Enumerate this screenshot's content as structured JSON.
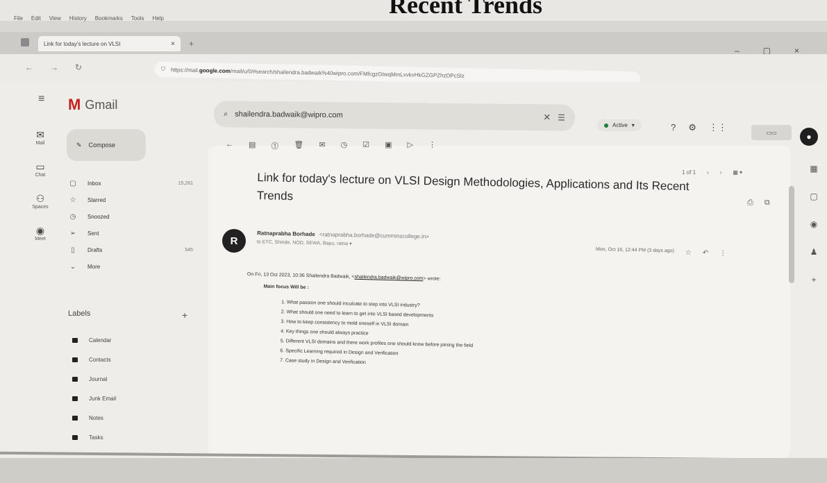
{
  "slide_title": "Recent Trends",
  "menu": [
    "File",
    "Edit",
    "View",
    "History",
    "Bookmarks",
    "Tools",
    "Help"
  ],
  "tab": {
    "title": "Link for today's lecture on VLSI",
    "close": "×",
    "new": "+"
  },
  "window_controls": [
    "–",
    "▢",
    "×"
  ],
  "nav": {
    "back": "←",
    "forward": "→",
    "reload": "↻"
  },
  "url": {
    "prefix": "https://mail.",
    "domain": "google.com",
    "rest": "/mail/u/0/#search/shailendra.badwaik%40wipro.com/FMfcgzGtwqMmLxvkvHkGZGPZhzDPcSlz"
  },
  "gmail": {
    "brand": "Gmail",
    "compose": "Compose",
    "rail": [
      {
        "icon": "✉",
        "label": "Mail"
      },
      {
        "icon": "▭",
        "label": "Chat"
      },
      {
        "icon": "⚇",
        "label": "Spaces"
      },
      {
        "icon": "◉",
        "label": "Meet"
      }
    ],
    "folders": [
      {
        "icon": "▢",
        "label": "Inbox",
        "count": "15,261"
      },
      {
        "icon": "☆",
        "label": "Starred",
        "count": ""
      },
      {
        "icon": "◷",
        "label": "Snoozed",
        "count": ""
      },
      {
        "icon": "➢",
        "label": "Sent",
        "count": ""
      },
      {
        "icon": "▯",
        "label": "Drafts",
        "count": "545"
      },
      {
        "icon": "⌄",
        "label": "More",
        "count": ""
      }
    ],
    "labels_heading": "Labels",
    "labels": [
      "Calendar",
      "Contacts",
      "Journal",
      "Junk Email",
      "Notes",
      "Tasks"
    ],
    "search": {
      "query": "shailendra.badwaik@wipro.com"
    },
    "status": "Active",
    "pager": "1 of 1",
    "subject": "Link for today's lecture on VLSI Design Methodologies, Applications and Its Recent Trends",
    "sender": {
      "initial": "R",
      "name": "Ratnaprabha Borhade",
      "email": "<ratnaprabha.borhade@cumminscollege.in>",
      "to": "to ETC, Shinde, NOD, SEWA, Bapu, ratna ▾"
    },
    "date": "Mon, Oct 16, 12:44 PM (3 days ago)",
    "quote_prefix": "On Fri, 13 Oct 2023, 10:36 Shailendra Badwaik, <",
    "quote_email": "shailendra.badwaik@wipro.com",
    "quote_suffix": "> wrote:",
    "focus": "Main focus Will be :",
    "points": [
      "What passion one should inculcate to step into VLSI industry?",
      "What should one need to learn to get into VLSI based developments",
      "How to keep consistency to mold oneself in VLSI domain",
      "Key things one should always practice",
      "Different VLSI domains and there work profiles one should know before joining the field",
      "Specific Learning required in Design and Verification",
      "Case study in Design and Verification"
    ]
  }
}
